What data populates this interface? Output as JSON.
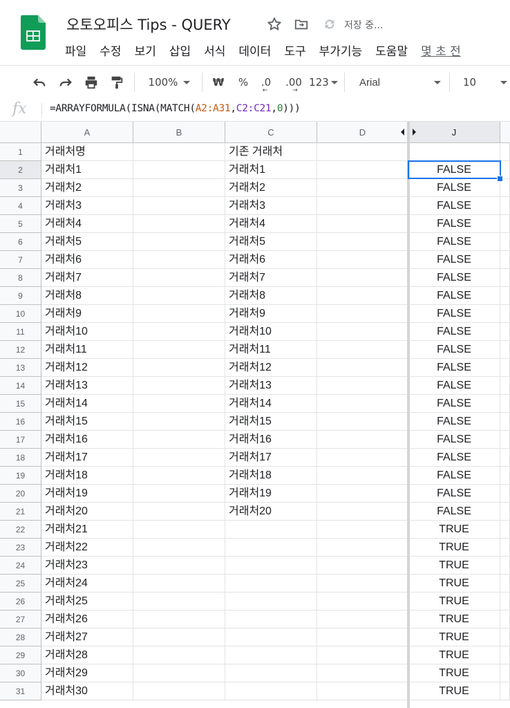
{
  "doc": {
    "title": "오토오피스 Tips - QUERY",
    "saving_status": "저장 중...",
    "icons": [
      "star-icon",
      "move-to-folder-icon",
      "sync-icon"
    ]
  },
  "menu": {
    "items": [
      "파일",
      "수정",
      "보기",
      "삽입",
      "서식",
      "데이터",
      "도구",
      "부가기능",
      "도움말"
    ],
    "last_edit": "몇 초 전"
  },
  "toolbar": {
    "zoom": "100%",
    "currency": "₩",
    "percent": "%",
    "dec_decrease": ".0",
    "dec_increase": ".00",
    "more_formats": "123",
    "font": "Arial",
    "font_size": "10"
  },
  "formula_bar": {
    "fx_label": "fx",
    "formula_parts": [
      "=ARRAYFORMULA(ISNA(MATCH(",
      "A2:A31",
      ",",
      "C2:C21",
      ",",
      "0",
      ")))"
    ]
  },
  "columns": [
    "A",
    "B",
    "C",
    "D",
    "J"
  ],
  "rows": [
    {
      "n": "1",
      "a": "거래처명",
      "c": "기존 거래처",
      "j": ""
    },
    {
      "n": "2",
      "a": "거래처1",
      "c": "거래처1",
      "j": "FALSE"
    },
    {
      "n": "3",
      "a": "거래처2",
      "c": "거래처2",
      "j": "FALSE"
    },
    {
      "n": "4",
      "a": "거래처3",
      "c": "거래처3",
      "j": "FALSE"
    },
    {
      "n": "5",
      "a": "거래처4",
      "c": "거래처4",
      "j": "FALSE"
    },
    {
      "n": "6",
      "a": "거래처5",
      "c": "거래처5",
      "j": "FALSE"
    },
    {
      "n": "7",
      "a": "거래처6",
      "c": "거래처6",
      "j": "FALSE"
    },
    {
      "n": "8",
      "a": "거래처7",
      "c": "거래처7",
      "j": "FALSE"
    },
    {
      "n": "9",
      "a": "거래처8",
      "c": "거래처8",
      "j": "FALSE"
    },
    {
      "n": "10",
      "a": "거래처9",
      "c": "거래처9",
      "j": "FALSE"
    },
    {
      "n": "11",
      "a": "거래처10",
      "c": "거래처10",
      "j": "FALSE"
    },
    {
      "n": "12",
      "a": "거래처11",
      "c": "거래처11",
      "j": "FALSE"
    },
    {
      "n": "13",
      "a": "거래처12",
      "c": "거래처12",
      "j": "FALSE"
    },
    {
      "n": "14",
      "a": "거래처13",
      "c": "거래처13",
      "j": "FALSE"
    },
    {
      "n": "15",
      "a": "거래처14",
      "c": "거래처14",
      "j": "FALSE"
    },
    {
      "n": "16",
      "a": "거래처15",
      "c": "거래처15",
      "j": "FALSE"
    },
    {
      "n": "17",
      "a": "거래처16",
      "c": "거래처16",
      "j": "FALSE"
    },
    {
      "n": "18",
      "a": "거래처17",
      "c": "거래처17",
      "j": "FALSE"
    },
    {
      "n": "19",
      "a": "거래처18",
      "c": "거래처18",
      "j": "FALSE"
    },
    {
      "n": "20",
      "a": "거래처19",
      "c": "거래처19",
      "j": "FALSE"
    },
    {
      "n": "21",
      "a": "거래처20",
      "c": "거래처20",
      "j": "FALSE"
    },
    {
      "n": "22",
      "a": "거래처21",
      "c": "",
      "j": "TRUE"
    },
    {
      "n": "23",
      "a": "거래처22",
      "c": "",
      "j": "TRUE"
    },
    {
      "n": "24",
      "a": "거래처23",
      "c": "",
      "j": "TRUE"
    },
    {
      "n": "25",
      "a": "거래처24",
      "c": "",
      "j": "TRUE"
    },
    {
      "n": "26",
      "a": "거래처25",
      "c": "",
      "j": "TRUE"
    },
    {
      "n": "27",
      "a": "거래처26",
      "c": "",
      "j": "TRUE"
    },
    {
      "n": "28",
      "a": "거래처27",
      "c": "",
      "j": "TRUE"
    },
    {
      "n": "29",
      "a": "거래처28",
      "c": "",
      "j": "TRUE"
    },
    {
      "n": "30",
      "a": "거래처29",
      "c": "",
      "j": "TRUE"
    },
    {
      "n": "31",
      "a": "거래처30",
      "c": "",
      "j": "TRUE"
    }
  ],
  "selection": {
    "cell": "J2"
  },
  "colors": {
    "accent": "#1a73e8",
    "sheets_green": "#0f9d58"
  }
}
